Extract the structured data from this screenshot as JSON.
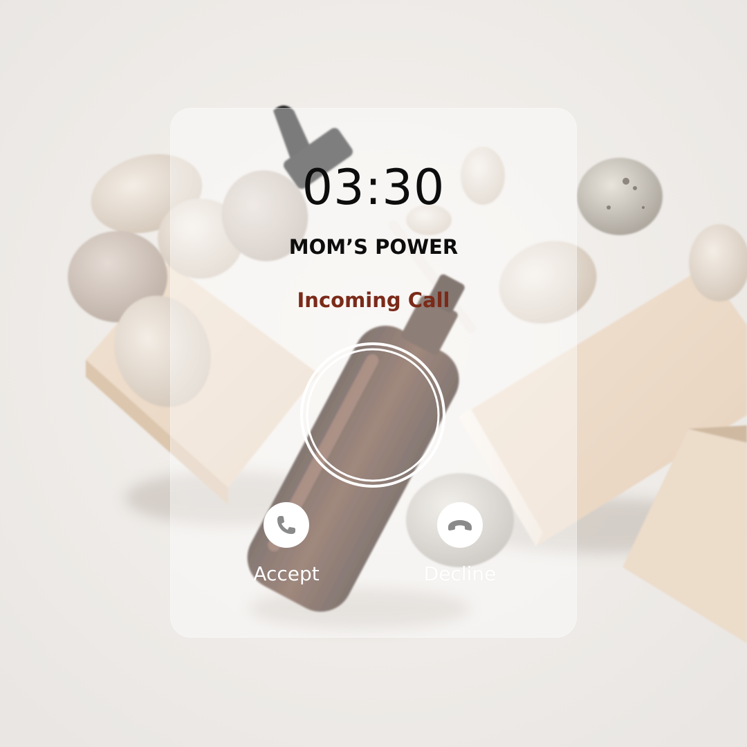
{
  "call": {
    "timer": "03:30",
    "caller_name": "MOM’S POWER",
    "status": "Incoming Call"
  },
  "actions": {
    "accept_label": "Accept",
    "decline_label": "Decline"
  },
  "icons": {
    "accept": "phone-icon",
    "decline": "phone-hangup-icon"
  },
  "colors": {
    "status_text": "#7b2a19",
    "button_label": "#ffffff",
    "card": "rgba(255,255,255,0.42)"
  }
}
